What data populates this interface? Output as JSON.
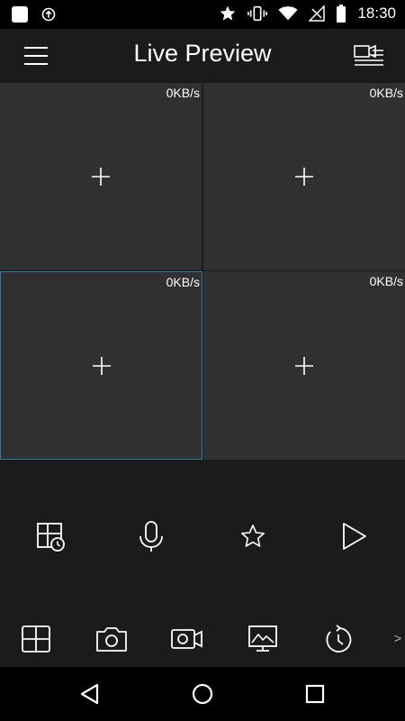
{
  "status_bar": {
    "time": "18:30",
    "icons": [
      "app-icon",
      "upload-icon",
      "star-icon",
      "vibrate-icon",
      "wifi-icon",
      "no-signal-icon",
      "battery-icon"
    ]
  },
  "app_bar": {
    "title": "Live Preview",
    "left_icon": "menu-icon",
    "right_icon": "device-list-icon"
  },
  "preview_grid": {
    "cells": [
      {
        "rate": "0KB/s",
        "selected": false
      },
      {
        "rate": "0KB/s",
        "selected": false
      },
      {
        "rate": "0KB/s",
        "selected": true
      },
      {
        "rate": "0KB/s",
        "selected": false
      }
    ]
  },
  "controls": [
    "playback-schedule-icon",
    "microphone-icon",
    "favorite-star-icon",
    "play-icon"
  ],
  "toolbar": {
    "items": [
      "split-screen-icon",
      "snapshot-icon",
      "record-icon",
      "image-quality-icon",
      "history-icon"
    ],
    "more": ">"
  },
  "nav_bar": [
    "back-icon",
    "home-icon",
    "recents-icon"
  ],
  "colors": {
    "background": "#1b1b1b",
    "cell": "#303030",
    "selected_border": "#2e7fa8",
    "status_bar": "#000000"
  }
}
